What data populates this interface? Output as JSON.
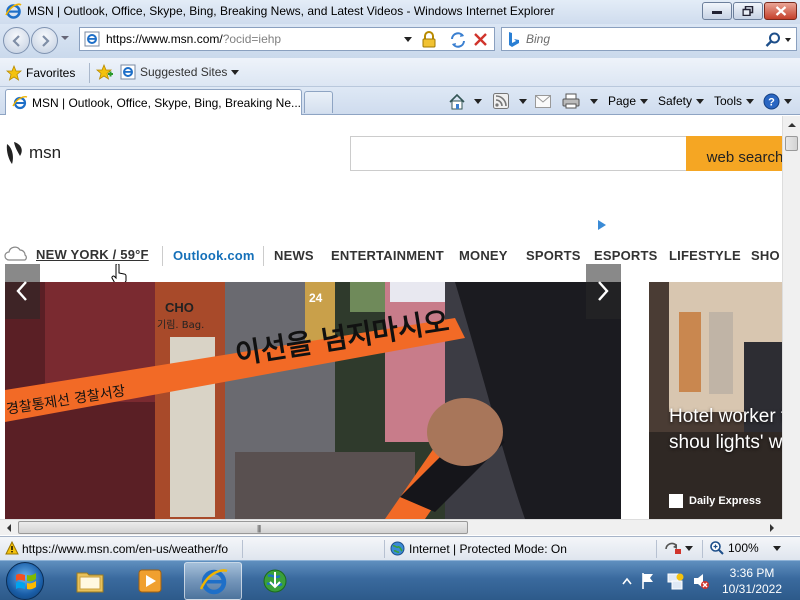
{
  "window": {
    "title": "MSN | Outlook, Office, Skype, Bing, Breaking News, and Latest Videos - Windows Internet Explorer"
  },
  "address": {
    "url_host": "https://www.msn.com/",
    "url_path": "?ocid=iehp"
  },
  "search": {
    "placeholder": "Bing"
  },
  "favorites_bar": {
    "favorites_label": "Favorites",
    "suggested_label": "Suggested Sites"
  },
  "tabs": [
    {
      "label": "MSN | Outlook, Office, Skype, Bing, Breaking Ne..."
    }
  ],
  "command_bar": {
    "page_label": "Page",
    "safety_label": "Safety",
    "tools_label": "Tools"
  },
  "msn": {
    "logo_text": "msn",
    "search_button": "web search",
    "weather": "NEW YORK / 59°F",
    "nav": [
      "Outlook.com",
      "NEWS",
      "ENTERTAINMENT",
      "MONEY",
      "SPORTS",
      "ESPORTS",
      "LIFESTYLE",
      "SHO"
    ],
    "hero_banner_text": "이선을 넘지마시오",
    "hero_sign_1": "CHO",
    "hero_sign_2": "기림. Bag.",
    "hero_sign_3": "24",
    "tape_text": "경찰통제선  경찰서장",
    "side_headline": "Hotel worker tourists shou lights' when t",
    "side_source": "Daily Express"
  },
  "status": {
    "url": "https://www.msn.com/en-us/weather/fo",
    "zone": "Internet | Protected Mode: On",
    "zoom": "100%"
  },
  "clock": {
    "time": "3:36 PM",
    "date": "10/31/2022"
  },
  "colors": {
    "accent_orange": "#f5a623",
    "outlook_blue": "#1570b9",
    "tape_orange": "#f26a26"
  }
}
